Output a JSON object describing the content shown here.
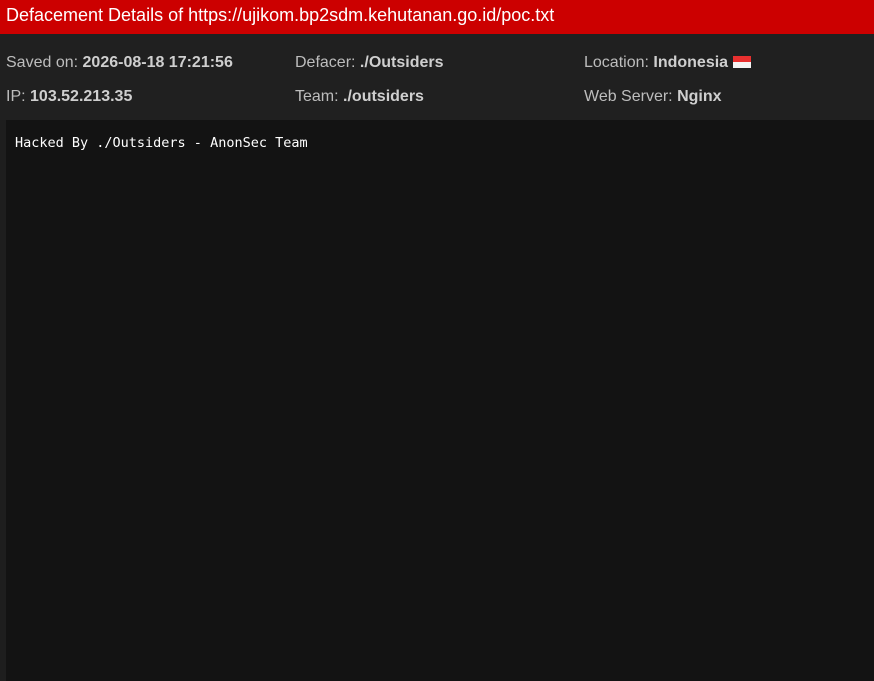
{
  "header": {
    "title": "Defacement Details of https://ujikom.bp2sdm.kehutanan.go.id/poc.txt"
  },
  "info": {
    "saved_label": "Saved on:",
    "saved_value": "2026-08-18 17:21:56",
    "defacer_label": "Defacer:",
    "defacer_value": "./Outsiders",
    "location_label": "Location:",
    "location_value": "Indonesia",
    "location_flag_icon": "indonesia-flag-icon",
    "ip_label": "IP:",
    "ip_value": "103.52.213.35",
    "team_label": "Team:",
    "team_value": "./outsiders",
    "server_label": "Web Server:",
    "server_value": "Nginx"
  },
  "content": {
    "text": "Hacked By ./Outsiders - AnonSec Team"
  },
  "colors": {
    "header_bg": "#cc0000",
    "info_bg": "#202020",
    "content_bg": "#131313"
  }
}
